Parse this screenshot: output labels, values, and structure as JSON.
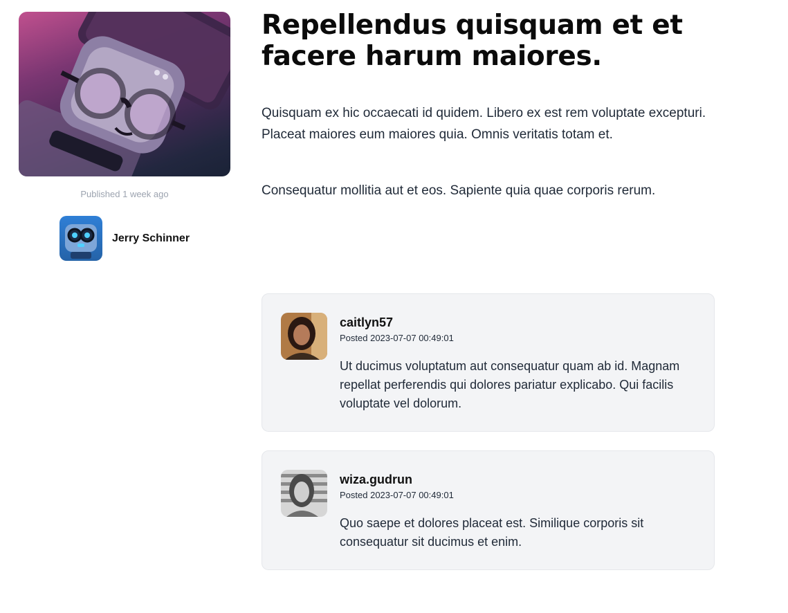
{
  "article": {
    "title": "Repellendus quisquam et et facere harum maiores.",
    "paragraphs": [
      "Quisquam ex hic occaecati id quidem. Libero ex est rem voluptate excepturi. Placeat maiores eum maiores quia. Omnis veritatis totam et.",
      "Consequatur mollitia aut et eos. Sapiente quia quae corporis rerum."
    ],
    "published": "Published 1 week ago",
    "cover_image": "robot-with-glasses-illustration",
    "author": {
      "name": "Jerry Schinner",
      "avatar_icon": "robot-avatar-icon"
    }
  },
  "comments": [
    {
      "user": "caitlyn57",
      "posted": "Posted 2023-07-07 00:49:01",
      "text": "Ut ducimus voluptatum aut consequatur quam ab id. Magnam repellat perferendis qui dolores pariatur explicabo. Qui facilis voluptate vel dolorum.",
      "avatar_icon": "user-photo-avatar"
    },
    {
      "user": "wiza.gudrun",
      "posted": "Posted 2023-07-07 00:49:01",
      "text": "Quo saepe et dolores placeat est. Similique corporis sit consequatur sit ducimus et enim.",
      "avatar_icon": "user-photo-avatar"
    }
  ],
  "colors": {
    "comment_background": "#f3f4f6",
    "muted_text": "#9ca3af",
    "heading_text": "#0b0b0b"
  }
}
